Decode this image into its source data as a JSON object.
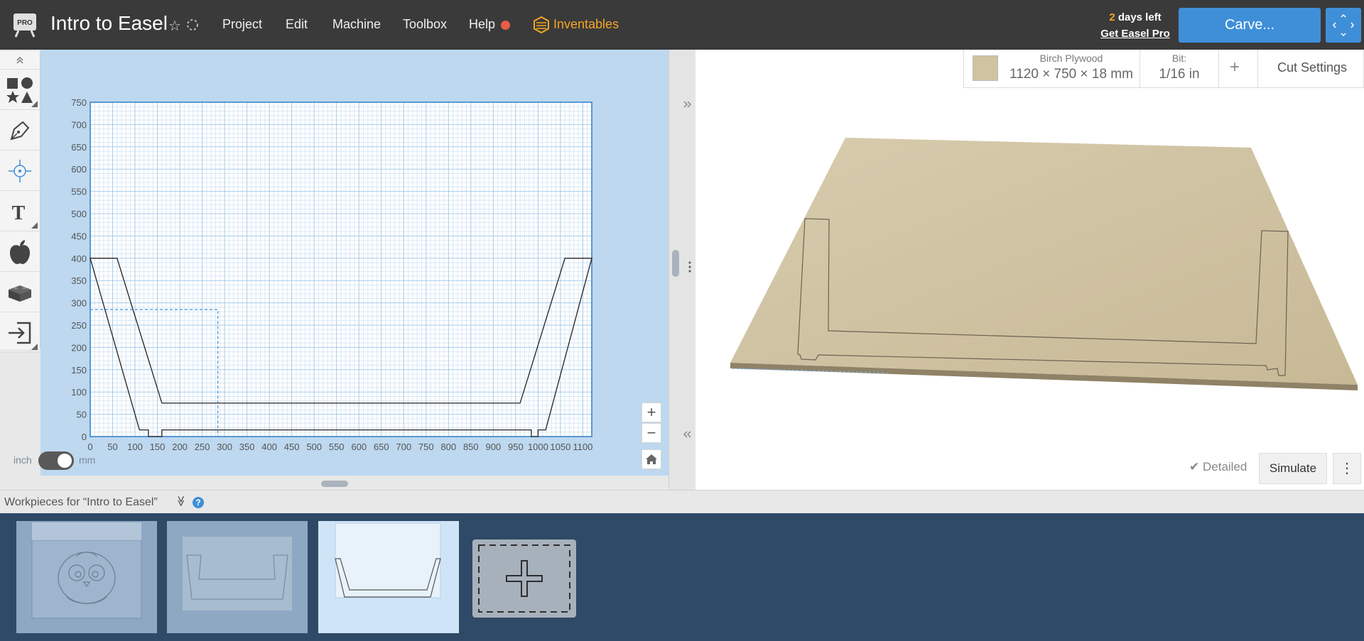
{
  "app": {
    "project_title": "Intro to Easel",
    "logo_badge": "PRO",
    "menu": [
      "Project",
      "Edit",
      "Machine",
      "Toolbox",
      "Help"
    ],
    "inventables_label": "Inventables",
    "trial_days": "2",
    "trial_suffix": " days left",
    "get_pro_label": "Get Easel Pro",
    "carve_label": "Carve...",
    "colors": {
      "topbar": "#3a3a3a",
      "accent": "#3f8fd8",
      "inventables": "#f5a623",
      "help_dot": "#e85d45"
    }
  },
  "toolbar": {
    "tools": [
      "shapes-icon",
      "pen-icon",
      "point-icon",
      "text-icon",
      "apple-icon",
      "apps-icon",
      "import-icon"
    ],
    "text_tool_label": "T"
  },
  "canvas": {
    "unit_inch": "inch",
    "unit_mm": "mm",
    "unit_selected": "mm",
    "x_ticks": [
      "0",
      "50",
      "100",
      "150",
      "200",
      "250",
      "300",
      "350",
      "400",
      "450",
      "500",
      "550",
      "600",
      "650",
      "700",
      "750",
      "800",
      "850",
      "900",
      "950",
      "1000",
      "1050",
      "1100"
    ],
    "y_ticks": [
      "0",
      "50",
      "100",
      "150",
      "200",
      "250",
      "300",
      "350",
      "400",
      "450",
      "500",
      "550",
      "600",
      "650",
      "700",
      "750"
    ],
    "x_range": [
      0,
      1120
    ],
    "y_range": [
      0,
      750
    ],
    "selection_box_mm": {
      "x": [
        0,
        285
      ],
      "y": [
        0,
        285
      ]
    },
    "zoom_in": "+",
    "zoom_out": "−",
    "home_icon": "home-icon",
    "outline_shape_mm": {
      "outer": [
        [
          0,
          400
        ],
        [
          60,
          400
        ],
        [
          160,
          75
        ],
        [
          960,
          75
        ],
        [
          1060,
          400
        ],
        [
          1120,
          400
        ],
        [
          1017,
          15
        ],
        [
          1000,
          15
        ],
        [
          1000,
          0
        ],
        [
          985,
          0
        ],
        [
          985,
          15
        ],
        [
          160,
          15
        ],
        [
          160,
          0
        ],
        [
          130,
          0
        ],
        [
          130,
          15
        ],
        [
          110,
          15
        ]
      ]
    }
  },
  "preview": {
    "material_name": "Birch Plywood",
    "material_dims": "1120 × 750 × 18 mm",
    "bit_label": "Bit:",
    "bit_value": "1/16 in",
    "add_label": "+",
    "cut_settings_label": "Cut Settings",
    "detailed_check": "✔",
    "detailed_label": "Detailed",
    "simulate_label": "Simulate",
    "more_label": "⋮"
  },
  "workpieces": {
    "header_label": "Workpieces for “Intro to Easel”",
    "header_chevron": "≫",
    "help_label": "?",
    "items": [
      {
        "name": "workpiece-owl",
        "active": false
      },
      {
        "name": "workpiece-tray-3d",
        "active": false
      },
      {
        "name": "workpiece-tray-outline",
        "active": true
      }
    ]
  }
}
